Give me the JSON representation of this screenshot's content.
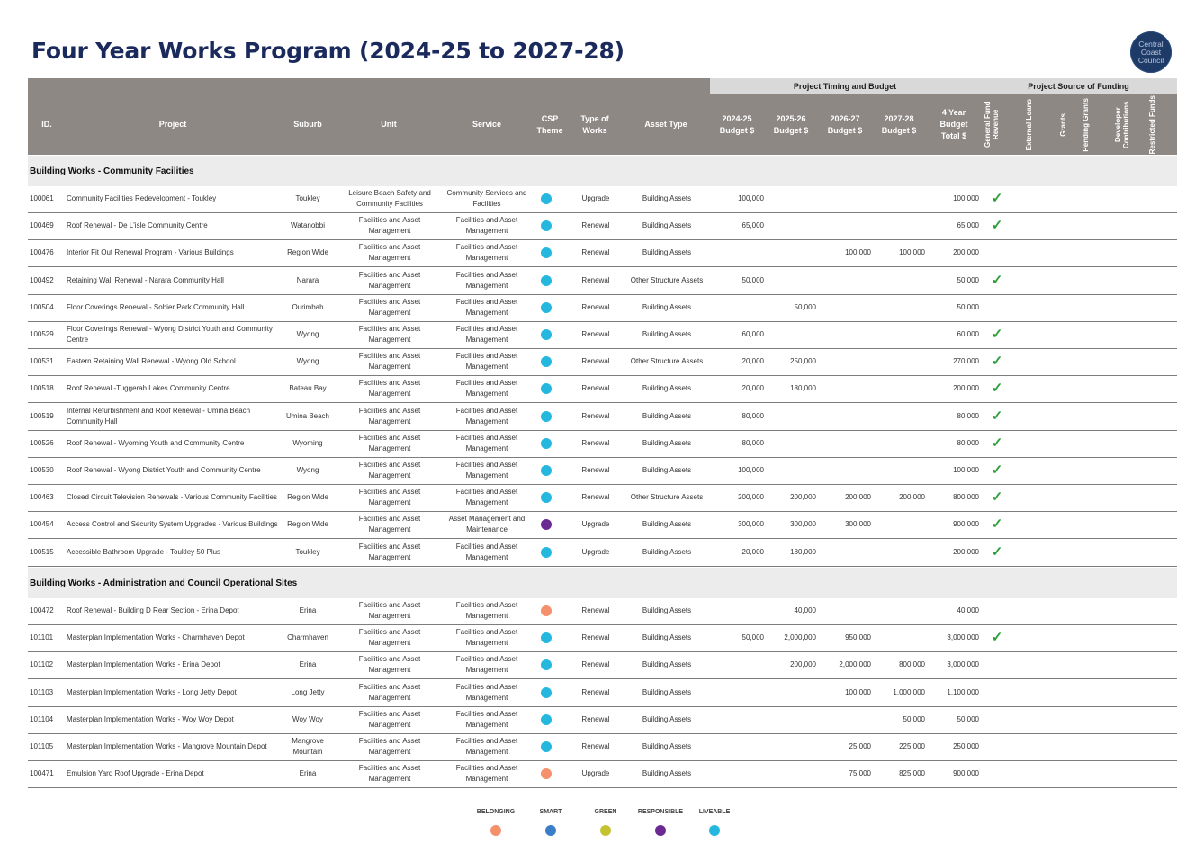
{
  "title": "Four Year Works Program (2024-25 to 2027-28)",
  "logo": {
    "lines": [
      "Central",
      "Coast",
      "Council"
    ]
  },
  "colors": {
    "belonging": "#f4906c",
    "smart": "#3a7dc9",
    "green": "#c4c231",
    "responsible": "#6a2a92",
    "liveable": "#25b8df",
    "check": "#2e9e3a",
    "header": "#8e8885"
  },
  "groups": {
    "timing": "Project Timing and Budget",
    "funding": "Project Source of Funding"
  },
  "headers": {
    "id": "ID.",
    "project": "Project",
    "suburb": "Suburb",
    "unit": "Unit",
    "service": "Service",
    "csp": "CSP Theme",
    "type": "Type of Works",
    "asset": "Asset Type",
    "y1": "2024-25 Budget $",
    "y2": "2025-26 Budget $",
    "y3": "2026-27 Budget $",
    "y4": "2027-28 Budget $",
    "total": "4 Year Budget Total $",
    "gfr": "General Fund Revenue",
    "loans": "External Loans",
    "grants": "Grants",
    "pending": "Pending Grants",
    "dev": "Developer Contributions",
    "restricted": "Restricted Funds"
  },
  "sections": [
    {
      "title": "Building Works - Community Facilities",
      "rows": [
        {
          "id": "100061",
          "project": "Community Facilities Redevelopment - Toukley",
          "suburb": "Toukley",
          "unit": "Leisure Beach Safety and Community Facilities",
          "service": "Community Services and Facilities",
          "csp": "liveable",
          "type": "Upgrade",
          "asset": "Building Assets",
          "y1": "100,000",
          "y2": "",
          "y3": "",
          "y4": "",
          "total": "100,000",
          "gfr": "✓"
        },
        {
          "id": "100469",
          "project": "Roof Renewal - De L'isle Community Centre",
          "suburb": "Watanobbi",
          "unit": "Facilities and Asset Management",
          "service": "Facilities and Asset Management",
          "csp": "liveable",
          "type": "Renewal",
          "asset": "Building Assets",
          "y1": "65,000",
          "y2": "",
          "y3": "",
          "y4": "",
          "total": "65,000",
          "gfr": "✓"
        },
        {
          "id": "100476",
          "project": "Interior Fit Out Renewal Program - Various Buildings",
          "suburb": "Region Wide",
          "unit": "Facilities and Asset Management",
          "service": "Facilities and Asset Management",
          "csp": "liveable",
          "type": "Renewal",
          "asset": "Building Assets",
          "y1": "",
          "y2": "",
          "y3": "100,000",
          "y4": "100,000",
          "total": "200,000",
          "gfr": ""
        },
        {
          "id": "100492",
          "project": "Retaining Wall Renewal - Narara Community Hall",
          "suburb": "Narara",
          "unit": "Facilities and Asset Management",
          "service": "Facilities and Asset Management",
          "csp": "liveable",
          "type": "Renewal",
          "asset": "Other Structure Assets",
          "y1": "50,000",
          "y2": "",
          "y3": "",
          "y4": "",
          "total": "50,000",
          "gfr": "✓"
        },
        {
          "id": "100504",
          "project": "Floor Coverings Renewal - Sohier Park Community Hall",
          "suburb": "Ourimbah",
          "unit": "Facilities and Asset Management",
          "service": "Facilities and Asset Management",
          "csp": "liveable",
          "type": "Renewal",
          "asset": "Building Assets",
          "y1": "",
          "y2": "50,000",
          "y3": "",
          "y4": "",
          "total": "50,000",
          "gfr": ""
        },
        {
          "id": "100529",
          "project": "Floor Coverings Renewal - Wyong District Youth and Community Centre",
          "suburb": "Wyong",
          "unit": "Facilities and Asset Management",
          "service": "Facilities and Asset Management",
          "csp": "liveable",
          "type": "Renewal",
          "asset": "Building Assets",
          "y1": "60,000",
          "y2": "",
          "y3": "",
          "y4": "",
          "total": "60,000",
          "gfr": "✓"
        },
        {
          "id": "100531",
          "project": "Eastern Retaining Wall Renewal - Wyong Old School",
          "suburb": "Wyong",
          "unit": "Facilities and Asset Management",
          "service": "Facilities and Asset Management",
          "csp": "liveable",
          "type": "Renewal",
          "asset": "Other Structure Assets",
          "y1": "20,000",
          "y2": "250,000",
          "y3": "",
          "y4": "",
          "total": "270,000",
          "gfr": "✓"
        },
        {
          "id": "100518",
          "project": "Roof Renewal -Tuggerah Lakes Community Centre",
          "suburb": "Bateau Bay",
          "unit": "Facilities and Asset Management",
          "service": "Facilities and Asset Management",
          "csp": "liveable",
          "type": "Renewal",
          "asset": "Building Assets",
          "y1": "20,000",
          "y2": "180,000",
          "y3": "",
          "y4": "",
          "total": "200,000",
          "gfr": "✓"
        },
        {
          "id": "100519",
          "project": "Internal Refurbishment and Roof Renewal - Umina Beach Community Hall",
          "suburb": "Umina Beach",
          "unit": "Facilities and Asset Management",
          "service": "Facilities and Asset Management",
          "csp": "liveable",
          "type": "Renewal",
          "asset": "Building Assets",
          "y1": "80,000",
          "y2": "",
          "y3": "",
          "y4": "",
          "total": "80,000",
          "gfr": "✓"
        },
        {
          "id": "100526",
          "project": "Roof Renewal - Wyoming Youth and Community Centre",
          "suburb": "Wyoming",
          "unit": "Facilities and Asset Management",
          "service": "Facilities and Asset Management",
          "csp": "liveable",
          "type": "Renewal",
          "asset": "Building Assets",
          "y1": "80,000",
          "y2": "",
          "y3": "",
          "y4": "",
          "total": "80,000",
          "gfr": "✓"
        },
        {
          "id": "100530",
          "project": "Roof Renewal - Wyong District Youth and Community Centre",
          "suburb": "Wyong",
          "unit": "Facilities and Asset Management",
          "service": "Facilities and Asset Management",
          "csp": "liveable",
          "type": "Renewal",
          "asset": "Building Assets",
          "y1": "100,000",
          "y2": "",
          "y3": "",
          "y4": "",
          "total": "100,000",
          "gfr": "✓"
        },
        {
          "id": "100463",
          "project": "Closed Circuit Television Renewals - Various Community Facilities",
          "suburb": "Region Wide",
          "unit": "Facilities and Asset Management",
          "service": "Facilities and Asset Management",
          "csp": "liveable",
          "type": "Renewal",
          "asset": "Other Structure Assets",
          "y1": "200,000",
          "y2": "200,000",
          "y3": "200,000",
          "y4": "200,000",
          "total": "800,000",
          "gfr": "✓"
        },
        {
          "id": "100454",
          "project": "Access Control and Security System Upgrades - Various Buildings",
          "suburb": "Region Wide",
          "unit": "Facilities and Asset Management",
          "service": "Asset Management and Maintenance",
          "csp": "responsible",
          "type": "Upgrade",
          "asset": "Building Assets",
          "y1": "300,000",
          "y2": "300,000",
          "y3": "300,000",
          "y4": "",
          "total": "900,000",
          "gfr": "✓"
        },
        {
          "id": "100515",
          "project": "Accessible Bathroom Upgrade - Toukley 50 Plus",
          "suburb": "Toukley",
          "unit": "Facilities and Asset Management",
          "service": "Facilities and Asset Management",
          "csp": "liveable",
          "type": "Upgrade",
          "asset": "Building Assets",
          "y1": "20,000",
          "y2": "180,000",
          "y3": "",
          "y4": "",
          "total": "200,000",
          "gfr": "✓"
        }
      ]
    },
    {
      "title": "Building Works - Administration and Council Operational Sites",
      "rows": [
        {
          "id": "100472",
          "project": "Roof Renewal - Building D Rear Section - Erina Depot",
          "suburb": "Erina",
          "unit": "Facilities and Asset Management",
          "service": "Facilities and Asset Management",
          "csp": "belonging",
          "type": "Renewal",
          "asset": "Building Assets",
          "y1": "",
          "y2": "40,000",
          "y3": "",
          "y4": "",
          "total": "40,000",
          "gfr": ""
        },
        {
          "id": "101101",
          "project": "Masterplan Implementation Works - Charmhaven Depot",
          "suburb": "Charmhaven",
          "unit": "Facilities and Asset Management",
          "service": "Facilities and Asset Management",
          "csp": "liveable",
          "type": "Renewal",
          "asset": "Building Assets",
          "y1": "50,000",
          "y2": "2,000,000",
          "y3": "950,000",
          "y4": "",
          "total": "3,000,000",
          "gfr": "✓"
        },
        {
          "id": "101102",
          "project": "Masterplan Implementation Works - Erina Depot",
          "suburb": "Erina",
          "unit": "Facilities and Asset Management",
          "service": "Facilities and Asset Management",
          "csp": "liveable",
          "type": "Renewal",
          "asset": "Building Assets",
          "y1": "",
          "y2": "200,000",
          "y3": "2,000,000",
          "y4": "800,000",
          "total": "3,000,000",
          "gfr": ""
        },
        {
          "id": "101103",
          "project": "Masterplan Implementation Works - Long Jetty Depot",
          "suburb": "Long Jetty",
          "unit": "Facilities and Asset Management",
          "service": "Facilities and Asset Management",
          "csp": "liveable",
          "type": "Renewal",
          "asset": "Building Assets",
          "y1": "",
          "y2": "",
          "y3": "100,000",
          "y4": "1,000,000",
          "total": "1,100,000",
          "gfr": ""
        },
        {
          "id": "101104",
          "project": "Masterplan Implementation Works - Woy Woy Depot",
          "suburb": "Woy Woy",
          "unit": "Facilities and Asset Management",
          "service": "Facilities and Asset Management",
          "csp": "liveable",
          "type": "Renewal",
          "asset": "Building Assets",
          "y1": "",
          "y2": "",
          "y3": "",
          "y4": "50,000",
          "total": "50,000",
          "gfr": ""
        },
        {
          "id": "101105",
          "project": "Masterplan Implementation Works - Mangrove Mountain Depot",
          "suburb": "Mangrove Mountain",
          "unit": "Facilities and Asset Management",
          "service": "Facilities and Asset Management",
          "csp": "liveable",
          "type": "Renewal",
          "asset": "Building Assets",
          "y1": "",
          "y2": "",
          "y3": "25,000",
          "y4": "225,000",
          "total": "250,000",
          "gfr": ""
        },
        {
          "id": "100471",
          "project": "Emulsion Yard Roof Upgrade - Erina Depot",
          "suburb": "Erina",
          "unit": "Facilities and Asset Management",
          "service": "Facilities and Asset Management",
          "csp": "belonging",
          "type": "Upgrade",
          "asset": "Building Assets",
          "y1": "",
          "y2": "",
          "y3": "75,000",
          "y4": "825,000",
          "total": "900,000",
          "gfr": ""
        }
      ]
    }
  ],
  "legend": [
    {
      "key": "belonging",
      "label": "BELONGING"
    },
    {
      "key": "smart",
      "label": "SMART"
    },
    {
      "key": "green",
      "label": "GREEN"
    },
    {
      "key": "responsible",
      "label": "RESPONSIBLE"
    },
    {
      "key": "liveable",
      "label": "LIVEABLE"
    }
  ]
}
